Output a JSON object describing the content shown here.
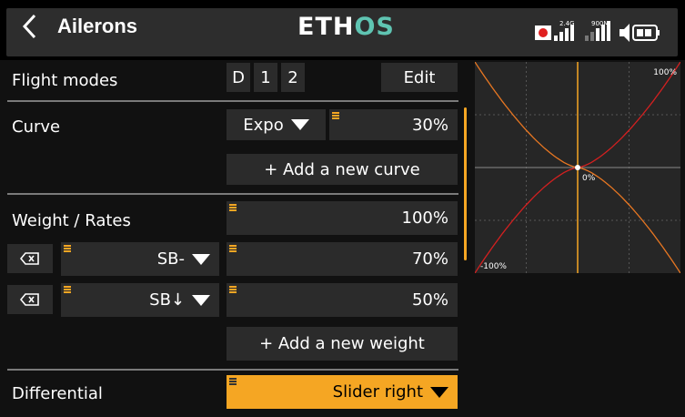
{
  "header": {
    "back_icon": "chevron-left-icon",
    "title": "Ailerons",
    "logo_part1": "ETH",
    "logo_part2": "OS",
    "status": {
      "rx_label": "2.4G",
      "tx_label": "900M"
    }
  },
  "flight_modes": {
    "label": "Flight modes",
    "modes": [
      "D",
      "1",
      "2"
    ],
    "edit": "Edit"
  },
  "curve": {
    "label": "Curve",
    "type": "Expo",
    "value": "30%",
    "add": "+ Add a new curve"
  },
  "weights": {
    "label": "Weight / Rates",
    "main_value": "100%",
    "rows": [
      {
        "switch": "SB-",
        "value": "70%"
      },
      {
        "switch": "SB↓",
        "value": "50%"
      }
    ],
    "add": "+ Add a new weight"
  },
  "differential": {
    "label": "Differential",
    "value": "Slider right"
  },
  "graph": {
    "max_label": "100%",
    "mid_label": "0%",
    "min_label": "-100%"
  },
  "colors": {
    "accent": "#f5a623",
    "curve1": "#e87722",
    "curve2": "#d42020"
  }
}
